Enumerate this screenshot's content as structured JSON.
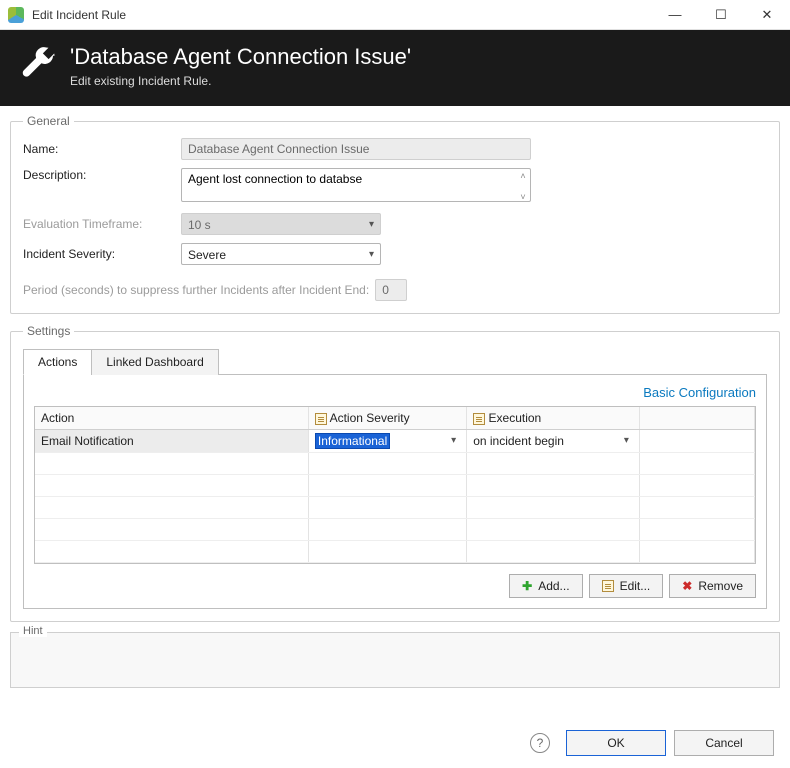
{
  "window": {
    "title": "Edit Incident Rule"
  },
  "header": {
    "title": "'Database Agent Connection Issue'",
    "subtitle": "Edit existing Incident Rule."
  },
  "general": {
    "legend": "General",
    "name_label": "Name:",
    "name_value": "Database Agent Connection Issue",
    "desc_label": "Description:",
    "desc_value": "Agent lost connection to databse",
    "eval_label": "Evaluation Timeframe:",
    "eval_value": "10 s",
    "severity_label": "Incident Severity:",
    "severity_value": "Severe",
    "suppress_label": "Period (seconds) to suppress further Incidents after Incident End:",
    "suppress_value": "0"
  },
  "settings": {
    "legend": "Settings",
    "tabs": {
      "actions": "Actions",
      "linked": "Linked Dashboard"
    },
    "basic_link": "Basic Configuration",
    "columns": {
      "action": "Action",
      "severity": "Action Severity",
      "execution": "Execution"
    },
    "rows": [
      {
        "action": "Email Notification",
        "severity": "Informational",
        "execution": "on incident begin"
      }
    ],
    "buttons": {
      "add": "Add...",
      "edit": "Edit...",
      "remove": "Remove"
    }
  },
  "hint": {
    "label": "Hint"
  },
  "footer": {
    "ok": "OK",
    "cancel": "Cancel",
    "help": "?"
  }
}
